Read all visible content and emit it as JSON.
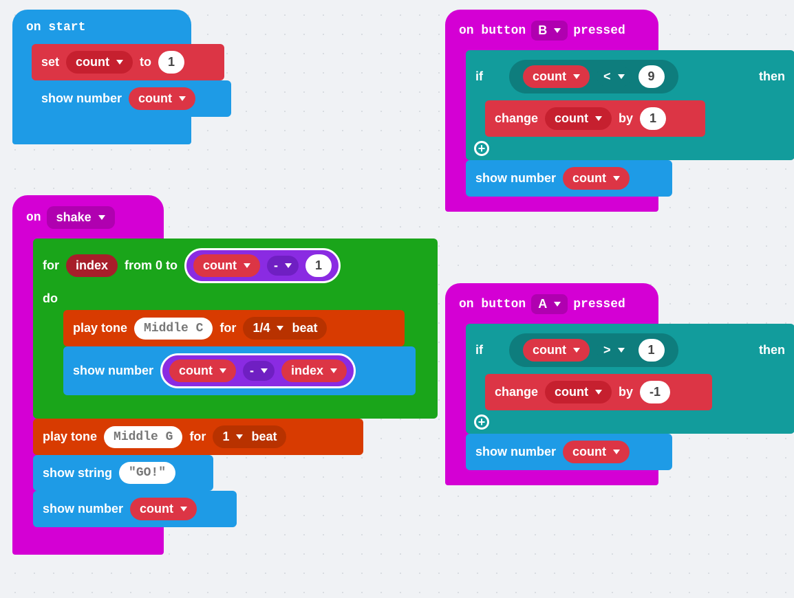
{
  "onStart": {
    "label": "on start",
    "set": {
      "word_set": "set",
      "var": "count",
      "word_to": "to",
      "val": "1"
    },
    "show": {
      "word": "show number",
      "var": "count"
    }
  },
  "onB": {
    "prefix": "on button",
    "button": "B",
    "suffix": "pressed",
    "if": {
      "word_if": "if",
      "var": "count",
      "op": "<",
      "val": "9",
      "word_then": "then"
    },
    "change": {
      "word": "change",
      "var": "count",
      "word_by": "by",
      "val": "1"
    },
    "show": {
      "word": "show number",
      "var": "count"
    }
  },
  "onA": {
    "prefix": "on button",
    "button": "A",
    "suffix": "pressed",
    "if": {
      "word_if": "if",
      "var": "count",
      "op": ">",
      "val": "1",
      "word_then": "then"
    },
    "change": {
      "word": "change",
      "var": "count",
      "word_by": "by",
      "val": "-1"
    },
    "show": {
      "word": "show number",
      "var": "count"
    }
  },
  "onShake": {
    "prefix": "on",
    "gesture": "shake",
    "for": {
      "word_for": "for",
      "var": "index",
      "word_from": "from 0 to",
      "limit_var": "count",
      "limit_op": "-",
      "limit_val": "1",
      "word_do": "do"
    },
    "play1": {
      "word": "play tone",
      "note": "Middle C",
      "word_for": "for",
      "beat": "1/4",
      "word_beat": "beat"
    },
    "show_expr": {
      "word": "show number",
      "a": "count",
      "op": "-",
      "b": "index"
    },
    "play2": {
      "word": "play tone",
      "note": "Middle G",
      "word_for": "for",
      "beat": "1",
      "word_beat": "beat"
    },
    "show_str": {
      "word": "show string",
      "val": "\"GO!\""
    },
    "show_num": {
      "word": "show number",
      "var": "count"
    }
  }
}
